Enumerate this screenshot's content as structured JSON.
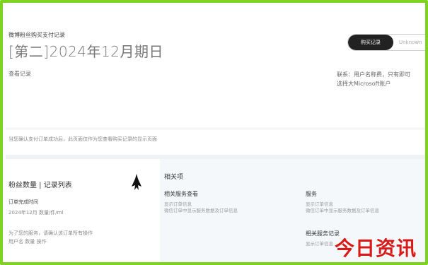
{
  "header": {
    "kicker": "微博粉丝购买支付记录",
    "title": "[第二]2024年12月期日",
    "subtitle_left": "查看记录",
    "subtitle_right_line1": "联系：用户名称费，只有即可",
    "subtitle_right_line2": "选择大Microsoft账户"
  },
  "toggle": {
    "active_label": "购买记录",
    "inactive_label": "Unknown"
  },
  "notice": "当您确认支付订单成功后，此页面仅作为您查看购买记录的显示页面",
  "left_section": {
    "heading": "粉丝数量 | 记录列表",
    "item_label": "订单完成时间",
    "item_meta": "2024年12月 数量/件/ml",
    "line1": "为了您的服务，请确认该订单所有操作",
    "line2": "用户名 数量 操作"
  },
  "right_panel": {
    "heading": "相关项",
    "cards": [
      {
        "title": "相关服务查看",
        "sub1": "显示订单信息",
        "sub2": "微信订单中显示服务数据及订单信息"
      },
      {
        "title": "服务",
        "sub1": "显示订单信息",
        "sub2": "微信订单中显示服务数据及订单信息"
      },
      {
        "title": "相关服务记录",
        "sub1": "显示订单信息",
        "sub2": ""
      }
    ]
  },
  "watermark": "今日资讯",
  "colors": {
    "frame": "#7ed321",
    "toggle_active": "#222222",
    "watermark": "#d71a1a",
    "panel_bg": "#f5f8fa"
  }
}
